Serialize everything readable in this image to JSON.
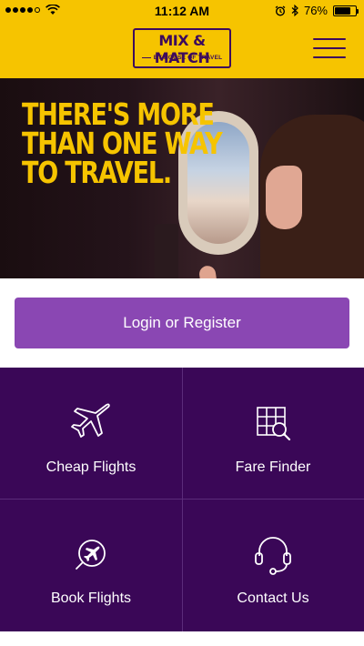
{
  "status_bar": {
    "time": "11:12 AM",
    "battery": "76%",
    "battery_level": 0.76,
    "signal_bars": 4,
    "icons": [
      "signal-dots",
      "wifi-icon",
      "alarm-icon",
      "bluetooth-icon",
      "battery-icon"
    ]
  },
  "header": {
    "logo_title": "MIX & MATCH",
    "logo_subtitle": "BY HOUSE OF TRAVEL",
    "menu_icon": "hamburger-menu-icon"
  },
  "hero": {
    "lines": [
      "THERE'S MORE",
      "THAN ONE WAY",
      "TO TRAVEL."
    ]
  },
  "login": {
    "label": "Login or Register"
  },
  "tiles": [
    {
      "label": "Cheap Flights",
      "icon": "airplane-icon"
    },
    {
      "label": "Fare Finder",
      "icon": "grid-search-icon"
    },
    {
      "label": "Book Flights",
      "icon": "plane-compass-icon"
    },
    {
      "label": "Contact Us",
      "icon": "headset-icon"
    }
  ],
  "colors": {
    "brand_yellow": "#f6c400",
    "brand_purple": "#3d0a5c",
    "button_purple": "#8a47b3",
    "grid_purple": "#3a0757"
  }
}
